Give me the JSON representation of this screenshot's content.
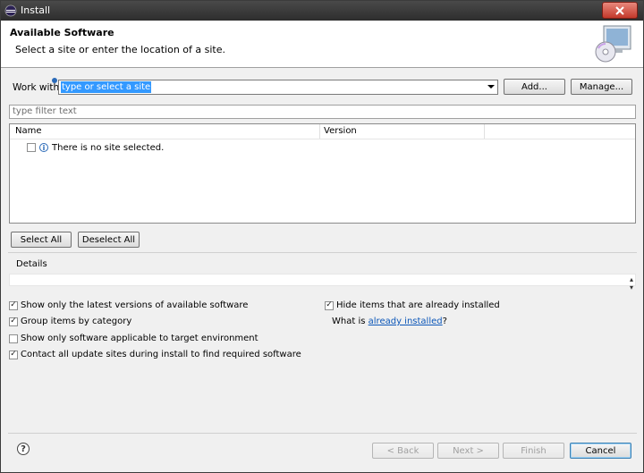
{
  "window": {
    "title": "Install"
  },
  "header": {
    "title": "Available Software",
    "subtitle": "Select a site or enter the location of a site."
  },
  "work_with": {
    "label": "Work with:",
    "value": "type or select a site",
    "add_label": "Add...",
    "manage_label": "Manage..."
  },
  "filter": {
    "placeholder": "type filter text"
  },
  "table": {
    "columns": [
      "Name",
      "Version"
    ],
    "rows": [
      {
        "name": "There is no site selected.",
        "checked": false
      }
    ]
  },
  "selection": {
    "select_all_label": "Select All",
    "deselect_all_label": "Deselect All"
  },
  "details": {
    "label": "Details"
  },
  "options": {
    "latest_versions": {
      "label": "Show only the latest versions of available software",
      "checked": true
    },
    "group_by_category": {
      "label": "Group items by category",
      "checked": true
    },
    "target_env": {
      "label": "Show only software applicable to target environment",
      "checked": false
    },
    "contact_sites": {
      "label": "Contact all update sites during install to find required software",
      "checked": true
    },
    "hide_installed": {
      "label": "Hide items that are already installed",
      "checked": true
    },
    "what_is_prefix": "What is",
    "already_installed_link": "already installed",
    "what_is_suffix": "?"
  },
  "footer": {
    "back_label": "< Back",
    "next_label": "Next >",
    "finish_label": "Finish",
    "cancel_label": "Cancel"
  },
  "colors": {
    "accent": "#3399ff",
    "link": "#0b56b8",
    "close_button": "#c2392b"
  },
  "icons": [
    "eclipse-icon",
    "close-icon",
    "install-cd-icon",
    "info-icon",
    "dropdown-arrow-icon",
    "help-icon"
  ]
}
